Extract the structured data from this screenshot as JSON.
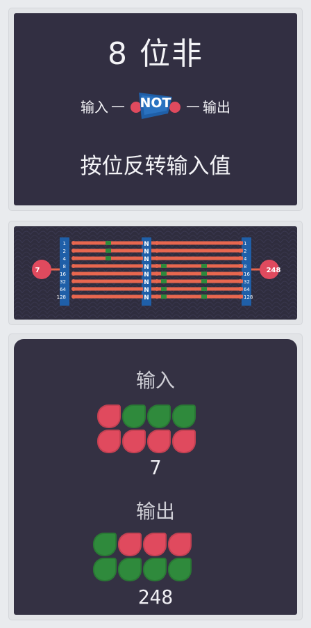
{
  "header": {
    "title": "8 位非",
    "input_label": "输入",
    "output_label": "输出",
    "dash": "—",
    "gate_label": "NOT",
    "description": "按位反转输入值"
  },
  "circuit": {
    "input_value": "7",
    "output_value": "248",
    "gate_letter": "N",
    "bit_labels": [
      "1",
      "2",
      "4",
      "8",
      "16",
      "32",
      "64",
      "128"
    ],
    "input_bits": [
      1,
      1,
      1,
      0,
      0,
      0,
      0,
      0
    ],
    "output_bits": [
      0,
      0,
      0,
      1,
      1,
      1,
      1,
      1
    ],
    "colors": {
      "wire": "#e8674f",
      "pin_active": "#2f8a3c",
      "bus": "#1f5fa8",
      "node": "#e04a5e"
    }
  },
  "summary": {
    "input_label": "输入",
    "input_value": "7",
    "input_bits": [
      1,
      1,
      1,
      0,
      0,
      0,
      0,
      0
    ],
    "output_label": "输出",
    "output_value": "248",
    "output_bits": [
      0,
      0,
      0,
      1,
      1,
      1,
      1,
      1
    ]
  }
}
